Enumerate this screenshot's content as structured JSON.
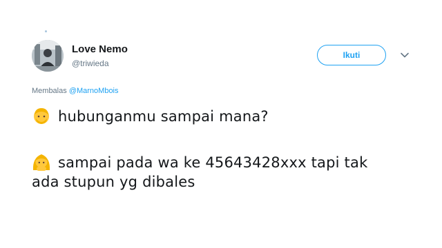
{
  "tweet": {
    "author": {
      "display_name": "Love Nemo",
      "handle": "@triwieda",
      "avatar_icon": "profile-photo"
    },
    "follow_label": "Ikuti",
    "menu_icon": "chevron-down-icon",
    "reply": {
      "prefix": "Membalas",
      "mention": "@MarnoMbois"
    },
    "lines": [
      {
        "emoji": "man-emoji",
        "text": "hubunganmu sampai mana?"
      },
      {
        "emoji": "girl-emoji",
        "text": "sampai pada wa ke 45643428xxx tapi tak"
      },
      {
        "text": "ada stupun yg dibales"
      }
    ]
  },
  "colors": {
    "accent": "#1da1f2",
    "text": "#14171a",
    "muted": "#657786",
    "emoji_yellow": "#ffc83d",
    "emoji_hair": "#f4b400"
  }
}
